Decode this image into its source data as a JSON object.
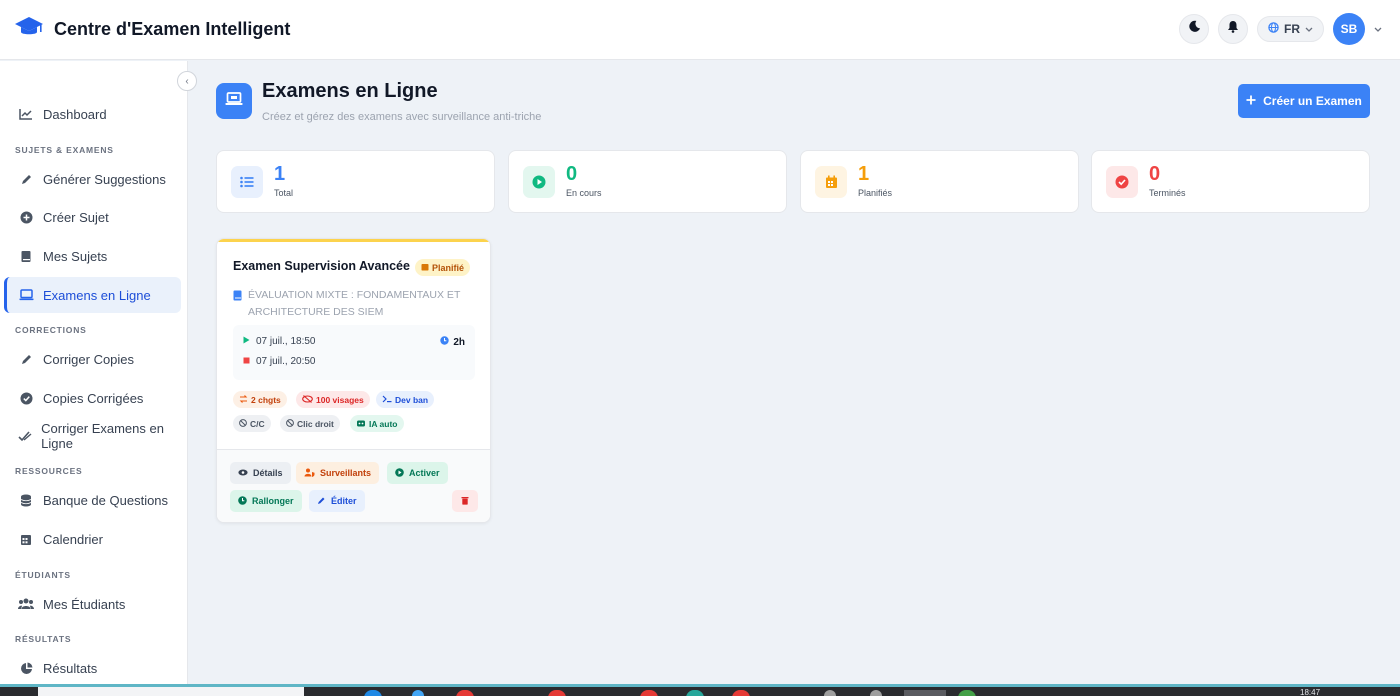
{
  "header": {
    "title": "Centre d'Examen Intelligent",
    "language": "FR",
    "avatar_initials": "SB"
  },
  "sidebar": {
    "dashboard": "Dashboard",
    "sections": {
      "sujets": "SUJETS & EXAMENS",
      "corrections": "CORRECTIONS",
      "ressources": "RESSOURCES",
      "etudiants": "ÉTUDIANTS",
      "resultats": "RÉSULTATS"
    },
    "items": {
      "generer": "Générer Suggestions",
      "creer_sujet": "Créer Sujet",
      "mes_sujets": "Mes Sujets",
      "examens_ligne": "Examens en Ligne",
      "corriger_copies": "Corriger Copies",
      "copies_corrigees": "Copies Corrigées",
      "corriger_examens": "Corriger Examens en Ligne",
      "banque": "Banque de Questions",
      "calendrier": "Calendrier",
      "mes_etudiants": "Mes Étudiants",
      "resultats": "Résultats"
    },
    "active": "examens_ligne"
  },
  "page": {
    "title": "Examens en Ligne",
    "subtitle": "Créez et gérez des examens avec surveillance anti-triche",
    "create_button": "Créer un Examen"
  },
  "stats": [
    {
      "value": "1",
      "label": "Total",
      "color": "#3b82f6",
      "bg": "#e8f0fd"
    },
    {
      "value": "0",
      "label": "En cours",
      "color": "#10b981",
      "bg": "#e3f7ef"
    },
    {
      "value": "1",
      "label": "Planifiés",
      "color": "#f59e0b",
      "bg": "#fef4e2"
    },
    {
      "value": "0",
      "label": "Terminés",
      "color": "#ef4444",
      "bg": "#fde8e8"
    }
  ],
  "exam": {
    "title": "Examen Supervision Avancée",
    "status": "Planifié",
    "subject": "Évaluation mixte : Fondamentaux et architecture des SIEM",
    "start": "07 juil., 18:50",
    "end": "07 juil., 20:50",
    "duration": "2h",
    "chips": {
      "changes": "2 chgts",
      "faces": "100 visages",
      "devtools": "Dev ban",
      "copy": "C/C",
      "right_click": "Clic droit",
      "ai": "IA auto"
    },
    "actions": {
      "details": "Détails",
      "surveillants": "Surveillants",
      "activer": "Activer",
      "rallonger": "Rallonger",
      "editer": "Éditer"
    }
  },
  "taskbar": {
    "clock": "18:47"
  }
}
